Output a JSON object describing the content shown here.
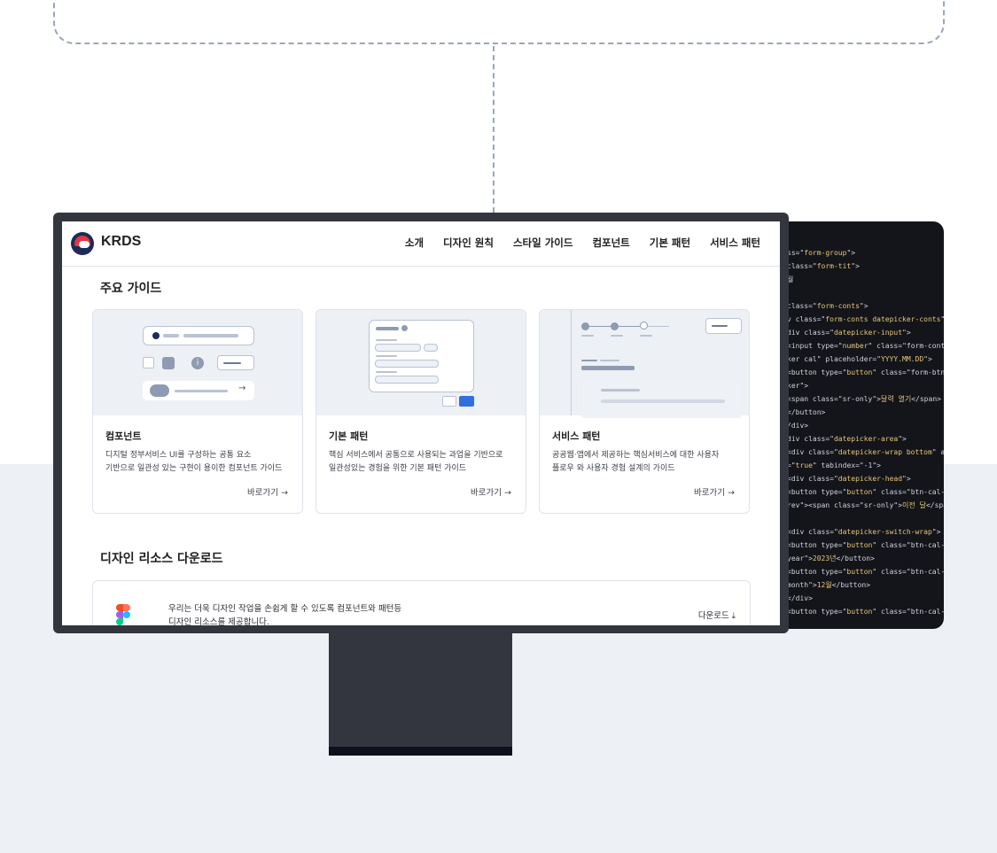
{
  "nav": {
    "brand": "KRDS",
    "menu": [
      "소개",
      "디자인 원칙",
      "스타일 가이드",
      "컴포넌트",
      "기본 패턴",
      "서비스 패턴"
    ]
  },
  "guides": {
    "title": "주요 가이드",
    "cards": [
      {
        "title": "컴포넌트",
        "desc1": "디지털 정부서비스 UI를 구성하는 공통 요소",
        "desc2": "기반으로 일관성 있는 구현이 용이한 컴포넌트 가이드",
        "link": "바로가기 →"
      },
      {
        "title": "기본 패턴",
        "desc1": "핵심 서비스에서 공통으로 사용되는 과업을 기반으로",
        "desc2": "일관성있는 경험을 위한 기본 패턴 가이드",
        "link": "바로가기 →"
      },
      {
        "title": "서비스 패턴",
        "desc1": "공공웹·앱에서 제공하는 핵심서비스에 대한 사용자",
        "desc2": "플로우 와 사용자 경험 설계의 가이드",
        "link": "바로가기 →"
      }
    ]
  },
  "download": {
    "title": "디자인 리소스 다운로드",
    "text1": "우리는 더욱 디자인 작업을 손쉽게 할 수 있도록 컴포넌트와 패턴등",
    "text2": "디자인 리소스를 제공합니다.",
    "button": "다운로드 ⤓"
  },
  "code": {
    "lines": [
      [
        "ss=\"",
        "form-group",
        "\">"
      ],
      [
        "class=\"",
        "form-tit",
        "\">"
      ],
      [
        "월",
        "",
        ""
      ],
      [
        "",
        "",
        ""
      ],
      [
        "class=\"",
        "form-conts",
        "\">"
      ],
      [
        "v class=\"",
        "form-conts datepicker-conts",
        "\">"
      ],
      [
        "div class=\"",
        "datepicker-input",
        "\">"
      ],
      [
        "  <input type=\"",
        "number",
        "\" class=\"form-control"
      ],
      [
        "ker cal\" placeholder=\"",
        "YYYY.MM.DD",
        "\">"
      ],
      [
        "  <button type=\"",
        "button",
        "\" class=\"form-btn-"
      ],
      [
        "ker\">",
        "",
        ""
      ],
      [
        "    <span class=\"sr-only\">",
        "달력 열기",
        "</span>"
      ],
      [
        "  </button>",
        "",
        ""
      ],
      [
        "/div>",
        "",
        ""
      ],
      [
        "div class=\"",
        "datepicker-area",
        "\">"
      ],
      [
        " <div class=\"",
        "datepicker-wrap bottom",
        "\" aria-"
      ],
      [
        "=\"",
        "true",
        "\" tabindex=\"-1\">"
      ],
      [
        "   <div class=\"",
        "datepicker-head",
        "\">"
      ],
      [
        "     <button type=\"",
        "button",
        "\" class=\"btn-cal-"
      ],
      [
        "rev\"><span class=\"sr-only\">",
        "이전 달",
        "</span></"
      ],
      [
        "",
        "",
        ""
      ],
      [
        "      <div class=\"",
        "datepicker-switch-wrap",
        "\">"
      ],
      [
        "        <button type=\"",
        "button",
        "\" class=\"btn-cal-"
      ],
      [
        "year\">",
        "2023년",
        "</button>"
      ],
      [
        "        <button type=\"",
        "button",
        "\" class=\"btn-cal-"
      ],
      [
        "month\">",
        "12월",
        "</button>"
      ],
      [
        "      </div>",
        "",
        ""
      ],
      [
        "     <button type=\"",
        "button",
        "\" class=\"btn-cal-···"
      ]
    ]
  }
}
